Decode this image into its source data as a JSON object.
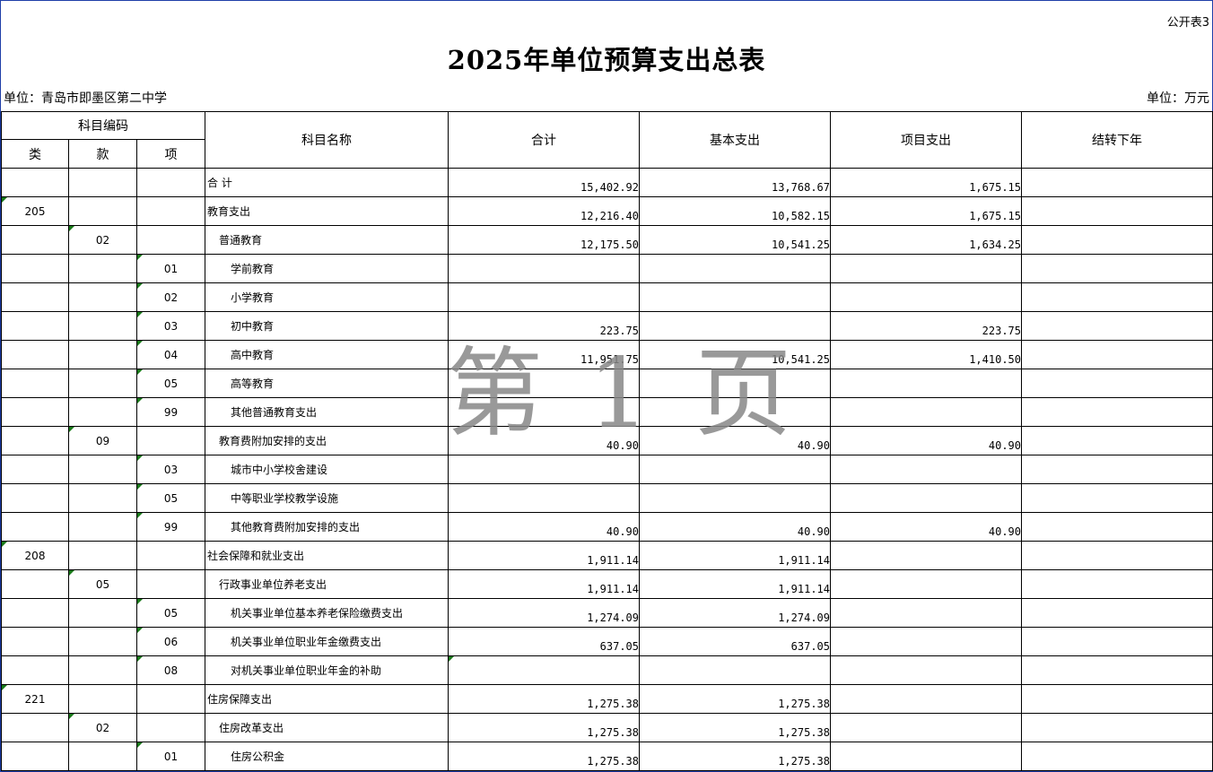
{
  "header": {
    "table_label": "公开表3",
    "title": "2025年单位预算支出总表",
    "unit_org": "单位：青岛市即墨区第二中学",
    "unit_currency": "单位：万元"
  },
  "columns": {
    "code_group": "科目编码",
    "lei": "类",
    "kuan": "款",
    "xiang": "项",
    "name": "科目名称",
    "total": "合计",
    "basic": "基本支出",
    "project": "项目支出",
    "carry": "结转下年"
  },
  "rows": [
    {
      "lei": "",
      "kuan": "",
      "xiang": "",
      "name": "合  计",
      "total": "15,402.92",
      "basic": "13,768.67",
      "project": "1,675.15",
      "carry": ""
    },
    {
      "lei": "205",
      "kuan": "",
      "xiang": "",
      "name": "教育支出",
      "total": "12,216.40",
      "basic": "10,582.15",
      "project": "1,675.15",
      "carry": ""
    },
    {
      "lei": "",
      "kuan": "02",
      "xiang": "",
      "name": "普通教育",
      "total": "12,175.50",
      "basic": "10,541.25",
      "project": "1,634.25",
      "carry": ""
    },
    {
      "lei": "",
      "kuan": "",
      "xiang": "01",
      "name": "学前教育",
      "total": "",
      "basic": "",
      "project": "",
      "carry": ""
    },
    {
      "lei": "",
      "kuan": "",
      "xiang": "02",
      "name": "小学教育",
      "total": "",
      "basic": "",
      "project": "",
      "carry": ""
    },
    {
      "lei": "",
      "kuan": "",
      "xiang": "03",
      "name": "初中教育",
      "total": "223.75",
      "basic": "",
      "project": "223.75",
      "carry": ""
    },
    {
      "lei": "",
      "kuan": "",
      "xiang": "04",
      "name": "高中教育",
      "total": "11,951.75",
      "basic": "10,541.25",
      "project": "1,410.50",
      "carry": ""
    },
    {
      "lei": "",
      "kuan": "",
      "xiang": "05",
      "name": "高等教育",
      "total": "",
      "basic": "",
      "project": "",
      "carry": ""
    },
    {
      "lei": "",
      "kuan": "",
      "xiang": "99",
      "name": "其他普通教育支出",
      "total": "",
      "basic": "",
      "project": "",
      "carry": ""
    },
    {
      "lei": "",
      "kuan": "09",
      "xiang": "",
      "name": "教育费附加安排的支出",
      "total": "40.90",
      "basic": "40.90",
      "project": "40.90",
      "carry": ""
    },
    {
      "lei": "",
      "kuan": "",
      "xiang": "03",
      "name": "城市中小学校舍建设",
      "total": "",
      "basic": "",
      "project": "",
      "carry": ""
    },
    {
      "lei": "",
      "kuan": "",
      "xiang": "05",
      "name": "中等职业学校教学设施",
      "total": "",
      "basic": "",
      "project": "",
      "carry": ""
    },
    {
      "lei": "",
      "kuan": "",
      "xiang": "99",
      "name": "其他教育费附加安排的支出",
      "total": "40.90",
      "basic": "40.90",
      "project": "40.90",
      "carry": ""
    },
    {
      "lei": "208",
      "kuan": "",
      "xiang": "",
      "name": "社会保障和就业支出",
      "total": "1,911.14",
      "basic": "1,911.14",
      "project": "",
      "carry": ""
    },
    {
      "lei": "",
      "kuan": "05",
      "xiang": "",
      "name": "行政事业单位养老支出",
      "total": "1,911.14",
      "basic": "1,911.14",
      "project": "",
      "carry": ""
    },
    {
      "lei": "",
      "kuan": "",
      "xiang": "05",
      "name": "机关事业单位基本养老保险缴费支出",
      "total": "1,274.09",
      "basic": "1,274.09",
      "project": "",
      "carry": ""
    },
    {
      "lei": "",
      "kuan": "",
      "xiang": "06",
      "name": "机关事业单位职业年金缴费支出",
      "total": "637.05",
      "basic": "637.05",
      "project": "",
      "carry": ""
    },
    {
      "lei": "",
      "kuan": "",
      "xiang": "08",
      "name": "对机关事业单位职业年金的补助",
      "total": "",
      "basic": "",
      "project": "",
      "carry": ""
    },
    {
      "lei": "221",
      "kuan": "",
      "xiang": "",
      "name": "住房保障支出",
      "total": "1,275.38",
      "basic": "1,275.38",
      "project": "",
      "carry": ""
    },
    {
      "lei": "",
      "kuan": "02",
      "xiang": "",
      "name": "住房改革支出",
      "total": "1,275.38",
      "basic": "1,275.38",
      "project": "",
      "carry": ""
    },
    {
      "lei": "",
      "kuan": "",
      "xiang": "01",
      "name": "住房公积金",
      "total": "1,275.38",
      "basic": "1,275.38",
      "project": "",
      "carry": ""
    }
  ],
  "watermark": "第 1 页",
  "colors": {
    "frame_border": "#1f3fa8",
    "cell_marker": "#1a7a1a",
    "watermark": "#888888"
  }
}
